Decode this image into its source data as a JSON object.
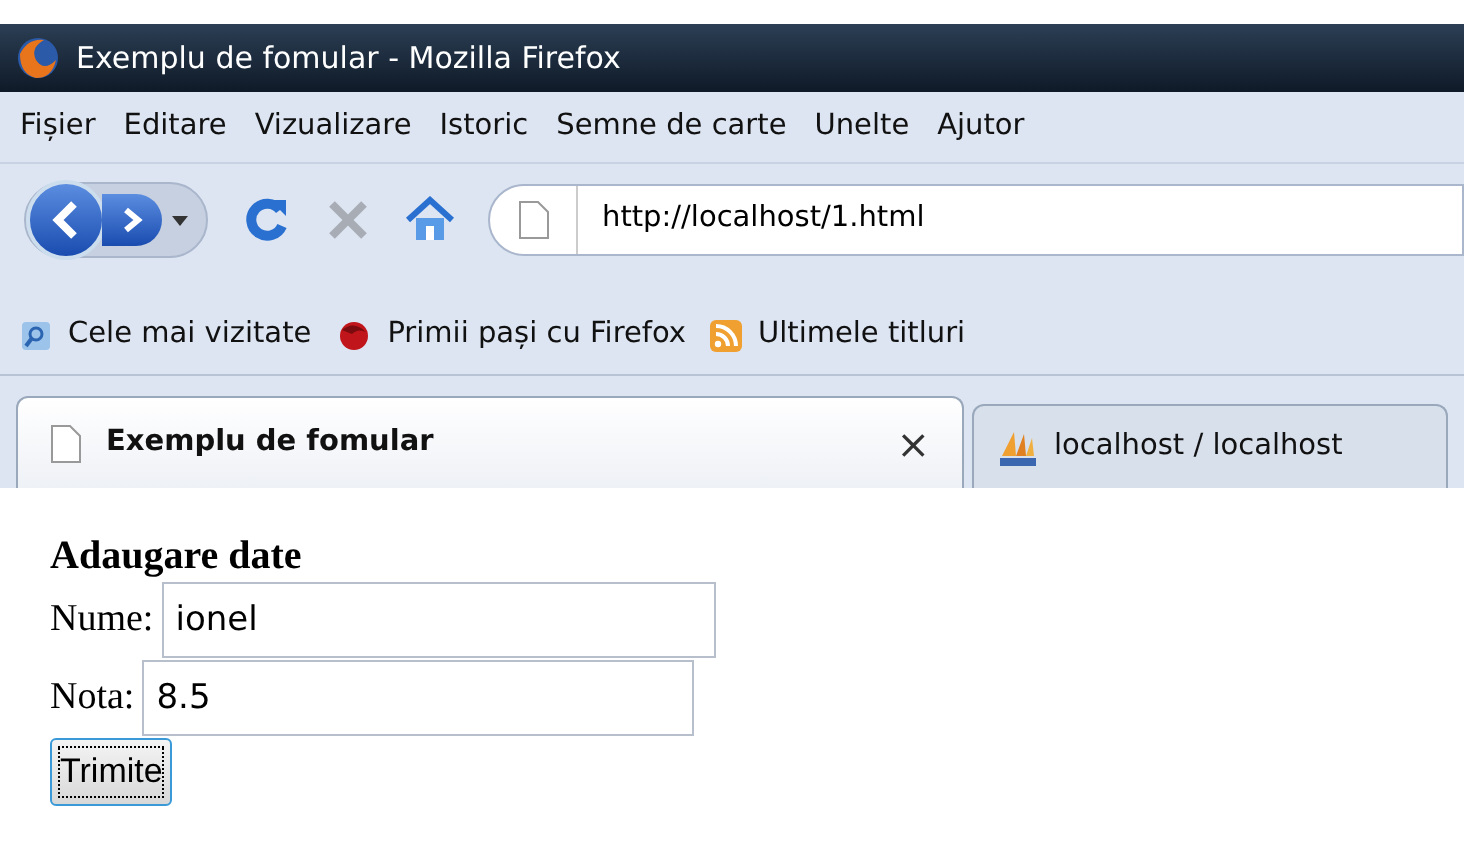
{
  "window": {
    "title": "Exemplu de fomular - Mozilla Firefox"
  },
  "menu": [
    "Fișier",
    "Editare",
    "Vizualizare",
    "Istoric",
    "Semne de carte",
    "Unelte",
    "Ajutor"
  ],
  "address": {
    "value": "http://localhost/1.html"
  },
  "bookmarks": [
    {
      "kind": "smart",
      "label": "Cele mai vizitate"
    },
    {
      "kind": "firefox",
      "label": "Primii pași cu Firefox"
    },
    {
      "kind": "feed",
      "label": "Ultimele titluri"
    }
  ],
  "tabs": [
    {
      "kind": "page",
      "label": "Exemplu de fomular",
      "selected": true,
      "close": "×"
    },
    {
      "kind": "pma",
      "label": "localhost / localhost",
      "selected": false
    }
  ],
  "form": {
    "heading": "Adaugare date",
    "fields": [
      {
        "label": "Nume:",
        "value": "ionel"
      },
      {
        "label": "Nota:",
        "value": "8.5"
      }
    ],
    "button": "Trimite"
  }
}
